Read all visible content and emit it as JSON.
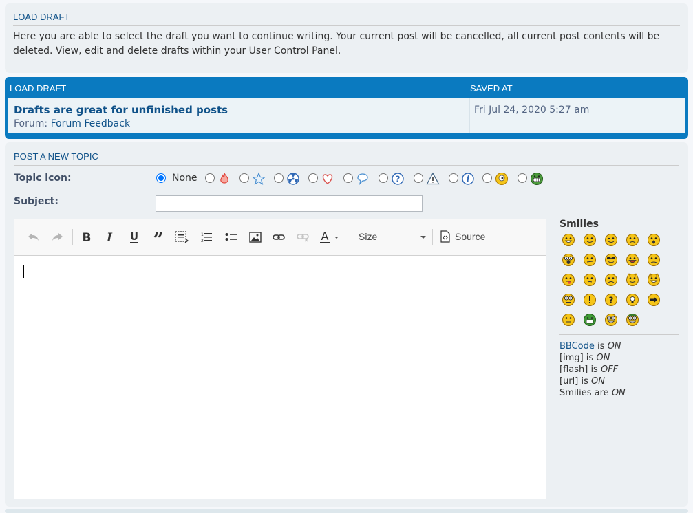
{
  "load_draft_panel": {
    "heading": "LOAD DRAFT",
    "description": "Here you are able to select the draft you want to continue writing. Your current post will be cancelled, all current post contents will be deleted. View, edit and delete drafts within your User Control Panel."
  },
  "drafts_table": {
    "columns": [
      "LOAD DRAFT",
      "SAVED AT"
    ],
    "rows": [
      {
        "title": "Drafts are great for unfinished posts",
        "forum_label": "Forum:",
        "forum_name": "Forum Feedback",
        "saved_at": "Fri Jul 24, 2020 5:27 am"
      }
    ]
  },
  "post_form": {
    "heading": "POST A NEW TOPIC",
    "topic_icon_label": "Topic icon:",
    "topic_icon_none_label": "None",
    "topic_icons": [
      "fire-icon",
      "star-icon",
      "radioactive-icon",
      "heart-icon",
      "speech-bubble-icon",
      "question-icon",
      "warning-icon",
      "info-icon",
      "smile-icon",
      "grin-icon"
    ],
    "subject_label": "Subject:",
    "subject_value": "",
    "toolbar": {
      "size_label": "Size",
      "source_label": "Source"
    },
    "editor_content": ""
  },
  "smilies": {
    "heading": "Smilies",
    "items": [
      "very-happy",
      "smile",
      "wink",
      "sad",
      "surprised",
      "shocked",
      "confused",
      "cool",
      "laughing",
      "mad",
      "razz",
      "embarrassed",
      "crying",
      "evil",
      "twisted-evil",
      "rolling-eyes",
      "exclamation",
      "question",
      "idea",
      "arrow",
      "neutral",
      "mr-green",
      "geek",
      "uber-geek"
    ]
  },
  "status": {
    "bbcode_link": "BBCode",
    "bbcode_text": "is",
    "bbcode_state": "ON",
    "img_text": "[img] is",
    "img_state": "ON",
    "flash_text": "[flash] is",
    "flash_state": "OFF",
    "url_text": "[url] is",
    "url_state": "ON",
    "smilies_text": "Smilies are",
    "smilies_state": "ON"
  },
  "colors": {
    "accent": "#0a7ac0",
    "link": "#105289",
    "panel": "#ecf0f3"
  }
}
